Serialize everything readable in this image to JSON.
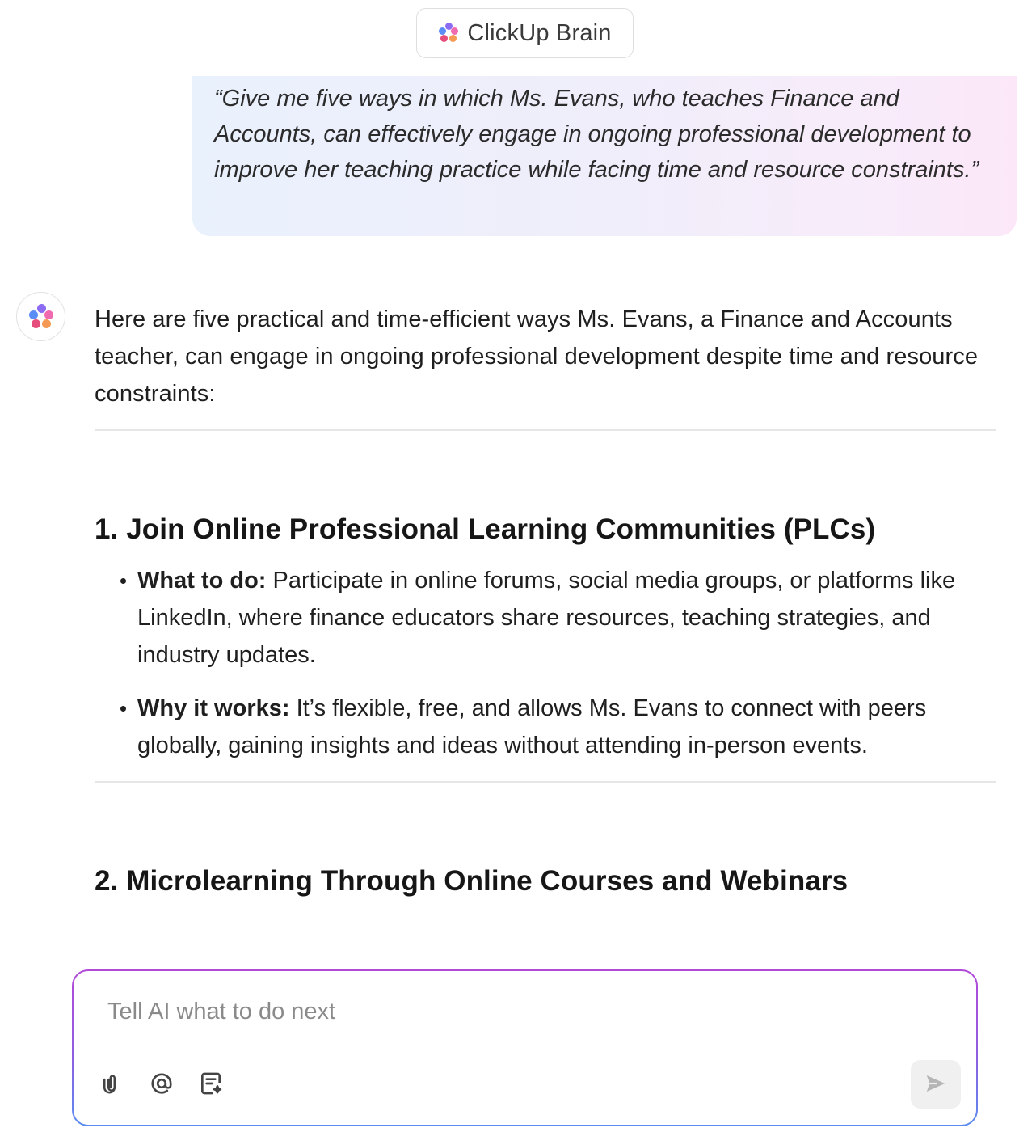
{
  "header": {
    "brand_label": "ClickUp Brain",
    "brand_icon": "clickup-brain-logo-icon"
  },
  "prompt": {
    "text": "“Give me five ways in which Ms. Evans, who teaches Finance and Accounts, can effectively engage in ongoing professional development to improve her teaching practice while facing time and resource constraints.”"
  },
  "response": {
    "avatar_icon": "clickup-brain-logo-icon",
    "intro": "Here are five practical and time-efficient ways Ms. Evans, a Finance and Accounts teacher, can engage in ongoing professional development despite time and resource constraints:",
    "sections": [
      {
        "heading": "1. Join Online Professional Learning Communities (PLCs)",
        "bullets": [
          {
            "lead": "What to do:",
            "text": " Participate in online forums, social media groups, or platforms like LinkedIn, where finance educators share resources, teaching strategies, and industry updates."
          },
          {
            "lead": "Why it works:",
            "text": " It’s flexible, free, and allows Ms. Evans to connect with peers globally, gaining insights and ideas without attending in-person events."
          }
        ]
      },
      {
        "heading": "2. Microlearning Through Online Courses and Webinars"
      }
    ]
  },
  "composer": {
    "placeholder": "Tell AI what to do next",
    "value": "",
    "tools": [
      "paperclip-icon",
      "at-mention-icon",
      "ai-note-icon"
    ],
    "send_icon": "send-arrow-icon"
  },
  "colors": {
    "bubble_gradient_start": "#e9f1fc",
    "bubble_gradient_end": "#fbe7f8",
    "input_border_top": "#b24ad9",
    "input_border_bottom": "#5a8cf0",
    "send_button_bg": "#f0f0f0"
  }
}
